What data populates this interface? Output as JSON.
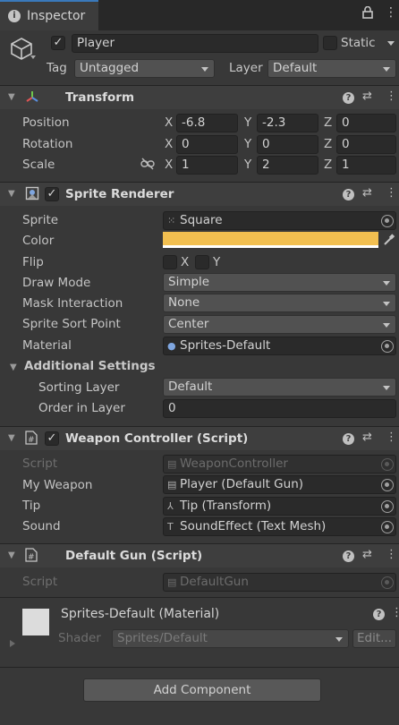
{
  "tab": {
    "label": "Inspector"
  },
  "object": {
    "name": "Player",
    "static_label": "Static",
    "tag_label": "Tag",
    "tag_value": "Untagged",
    "layer_label": "Layer",
    "layer_value": "Default"
  },
  "transform": {
    "title": "Transform",
    "position": {
      "label": "Position",
      "x": "-6.8",
      "y": "-2.3",
      "z": "0"
    },
    "rotation": {
      "label": "Rotation",
      "x": "0",
      "y": "0",
      "z": "0"
    },
    "scale": {
      "label": "Scale",
      "x": "1",
      "y": "2",
      "z": "1"
    },
    "axis": {
      "x": "X",
      "y": "Y",
      "z": "Z"
    }
  },
  "sprite_renderer": {
    "title": "Sprite Renderer",
    "sprite_label": "Sprite",
    "sprite_value": "Square",
    "color_label": "Color",
    "color_value": "#f2bf50",
    "flip_label": "Flip",
    "flip_x": "X",
    "flip_y": "Y",
    "draw_mode_label": "Draw Mode",
    "draw_mode_value": "Simple",
    "mask_label": "Mask Interaction",
    "mask_value": "None",
    "sort_point_label": "Sprite Sort Point",
    "sort_point_value": "Center",
    "material_label": "Material",
    "material_value": "Sprites-Default",
    "additional_label": "Additional Settings",
    "sorting_layer_label": "Sorting Layer",
    "sorting_layer_value": "Default",
    "order_label": "Order in Layer",
    "order_value": "0"
  },
  "weapon_controller": {
    "title": "Weapon Controller (Script)",
    "script_label": "Script",
    "script_value": "WeaponController",
    "my_weapon_label": "My Weapon",
    "my_weapon_value": "Player (Default Gun)",
    "tip_label": "Tip",
    "tip_value": "Tip (Transform)",
    "sound_label": "Sound",
    "sound_value": "SoundEffect (Text Mesh)"
  },
  "default_gun": {
    "title": "Default Gun (Script)",
    "script_label": "Script",
    "script_value": "DefaultGun"
  },
  "material": {
    "title": "Sprites-Default (Material)",
    "shader_label": "Shader",
    "shader_value": "Sprites/Default",
    "edit_label": "Edit..."
  },
  "add_component_label": "Add Component",
  "colors": {
    "accent_tab": "#3a79bb",
    "swatch": "#f2bf50",
    "background": "#383838"
  }
}
